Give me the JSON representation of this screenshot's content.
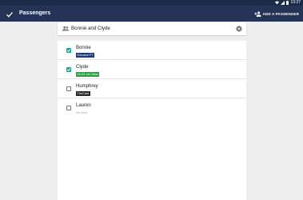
{
  "status_bar": {
    "time": "13:37"
  },
  "app_bar": {
    "title": "Passengers",
    "add_label": "ADD A PASSENGER"
  },
  "search": {
    "value": "Bonnie and Clyde"
  },
  "passengers": [
    {
      "name": "Bonnie",
      "checked": true,
      "card": "Eurostar FT",
      "card_color": "#1d3b7a"
    },
    {
      "name": "Clyde",
      "checked": true,
      "card": "16-25 1st Class",
      "card_color": "#2e9e41"
    },
    {
      "name": "Humphrey",
      "checked": false,
      "card": "TheCard",
      "card_color": "#2a2a2a"
    },
    {
      "name": "Lauren",
      "checked": false,
      "card": "No card"
    }
  ],
  "colors": {
    "app_bar": "#243356",
    "status_bar": "#1d2b4b",
    "checkbox_accent": "#1fa79a"
  },
  "icons": [
    "wifi-icon",
    "signal-icon",
    "battery-icon",
    "check-icon",
    "add-person-icon",
    "people-icon",
    "clear-icon",
    "checkbox-check-icon"
  ]
}
